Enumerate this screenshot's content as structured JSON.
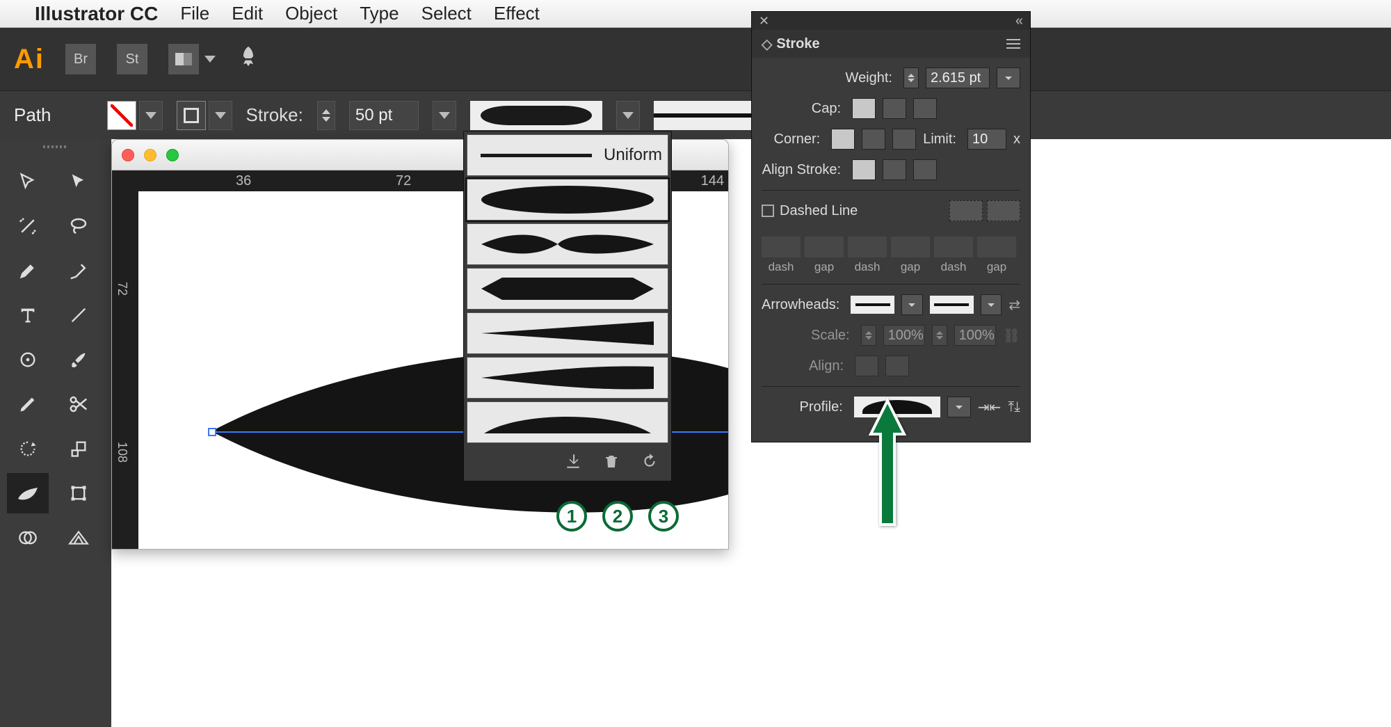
{
  "menubar": {
    "app": "Illustrator CC",
    "items": [
      "File",
      "Edit",
      "Object",
      "Type",
      "Select",
      "Effect"
    ]
  },
  "toprow": {
    "logo": "Ai",
    "chips": [
      "Br",
      "St"
    ]
  },
  "controlbar": {
    "mode": "Path",
    "stroke_label": "Stroke:",
    "stroke_value": "50 pt"
  },
  "ruler": {
    "h": [
      "36",
      "72",
      "144"
    ],
    "v": [
      "72",
      "108"
    ]
  },
  "profile_popup": {
    "uniform_label": "Uniform",
    "footer_buttons": [
      "save",
      "delete",
      "reset"
    ]
  },
  "annotation_numbers": [
    "1",
    "2",
    "3"
  ],
  "stroke_panel": {
    "title": "Stroke",
    "weight_label": "Weight:",
    "weight_value": "2.615 pt",
    "cap_label": "Cap:",
    "corner_label": "Corner:",
    "limit_label": "Limit:",
    "limit_value": "10",
    "limit_x": "x",
    "align_stroke_label": "Align Stroke:",
    "dashed_line_label": "Dashed Line",
    "dashgap_labels": [
      "dash",
      "gap",
      "dash",
      "gap",
      "dash",
      "gap"
    ],
    "arrowheads_label": "Arrowheads:",
    "scale_label": "Scale:",
    "scale_value": "100%",
    "align_label": "Align:",
    "profile_label": "Profile:"
  }
}
